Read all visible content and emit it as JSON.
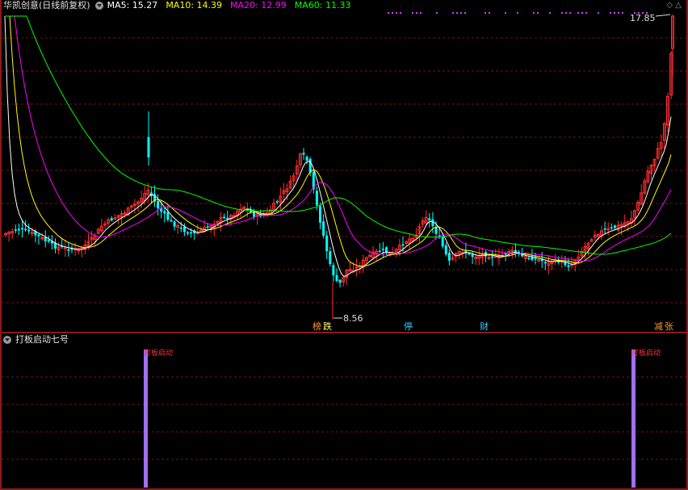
{
  "header": {
    "stock_name": "华凯创意(日线前复权)",
    "ma5": "MA5: 15.27",
    "ma10": "MA10: 14.39",
    "ma20": "MA20: 12.99",
    "ma60": "MA60: 11.33"
  },
  "colors": {
    "ma5": "#ffffff",
    "ma10": "#ffff00",
    "ma20": "#ff00ff",
    "ma60": "#00ff00",
    "up": "#ff3030",
    "down": "#00ffff",
    "grid": "#7a1010",
    "indicator_bar": "#a070f0",
    "indicator_text": "#ff3030"
  },
  "main_chart": {
    "price_high_label": "17.85",
    "price_low_label": "8.56",
    "events": [
      {
        "label": "榜",
        "color": "#ff9933"
      },
      {
        "label": "跌",
        "color": "#ffff66"
      },
      {
        "label": "停",
        "color": "#33ccff"
      },
      {
        "label": "财",
        "color": "#33ccff"
      },
      {
        "label": "减",
        "color": "#ff9933"
      },
      {
        "label": "张",
        "color": "#ff9933"
      }
    ]
  },
  "sub_chart": {
    "title": "打板启动七号",
    "signal_label": "打板启动"
  }
}
